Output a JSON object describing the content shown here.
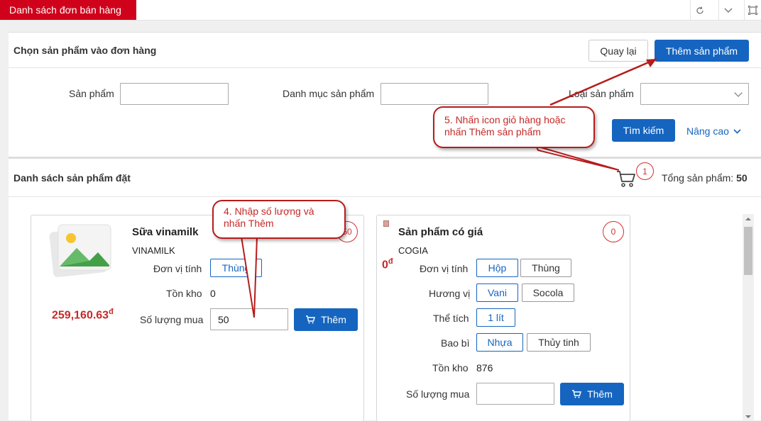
{
  "tab": {
    "title": "Danh sách đơn bán hàng"
  },
  "window_icons": [
    "refresh-icon",
    "chevron-down-icon",
    "maximize-icon"
  ],
  "header": {
    "title": "Chọn sản phẩm vào đơn hàng",
    "back_label": "Quay lại",
    "add_product_label": "Thêm sản phẩm"
  },
  "filters": {
    "product_label": "Sản phẩm",
    "product_value": "",
    "category_label": "Danh mục sản phẩm",
    "category_value": "",
    "type_label": "Loại sản phẩm",
    "type_value": "",
    "search_label": "Tìm kiếm",
    "advanced_label": "Nâng cao"
  },
  "ordered": {
    "title": "Danh sách sản phẩm đặt",
    "cart_count": "1",
    "total_label": "Tổng sản phẩm:",
    "total_value": "50"
  },
  "cards": [
    {
      "name": "Sữa vinamilk",
      "brand": "VINAMILK",
      "badge": "50",
      "price": "259,160.63",
      "currency": "đ",
      "unit_label": "Đơn vị tính",
      "units": [
        "Thùng"
      ],
      "stock_label": "Tồn kho",
      "stock_value": "0",
      "qty_label": "Số lượng mua",
      "qty_value": "50",
      "add_label": "Thêm"
    },
    {
      "name": "Sản phẩm có giá",
      "brand": "COGIA",
      "badge": "0",
      "price": "0",
      "currency": "đ",
      "unit_label": "Đơn vị tính",
      "units": [
        "Hộp",
        "Thùng"
      ],
      "flavor_label": "Hương vị",
      "flavors": [
        "Vani",
        "Socola"
      ],
      "volume_label": "Thể tích",
      "volumes": [
        "1 lít"
      ],
      "package_label": "Bao bì",
      "packages": [
        "Nhựa",
        "Thủy tinh"
      ],
      "stock_label": "Tồn kho",
      "stock_value": "876",
      "qty_label": "Số lượng mua",
      "qty_value": "",
      "add_label": "Thêm"
    }
  ],
  "callouts": {
    "step4": "4. Nhập số lượng và nhấn Thêm",
    "step5": "5. Nhấn icon giỏ hàng hoặc nhấn Thêm sản phẩm"
  },
  "colors": {
    "brand_red": "#d0021b",
    "primary": "#1565c0",
    "price": "#c62828"
  }
}
